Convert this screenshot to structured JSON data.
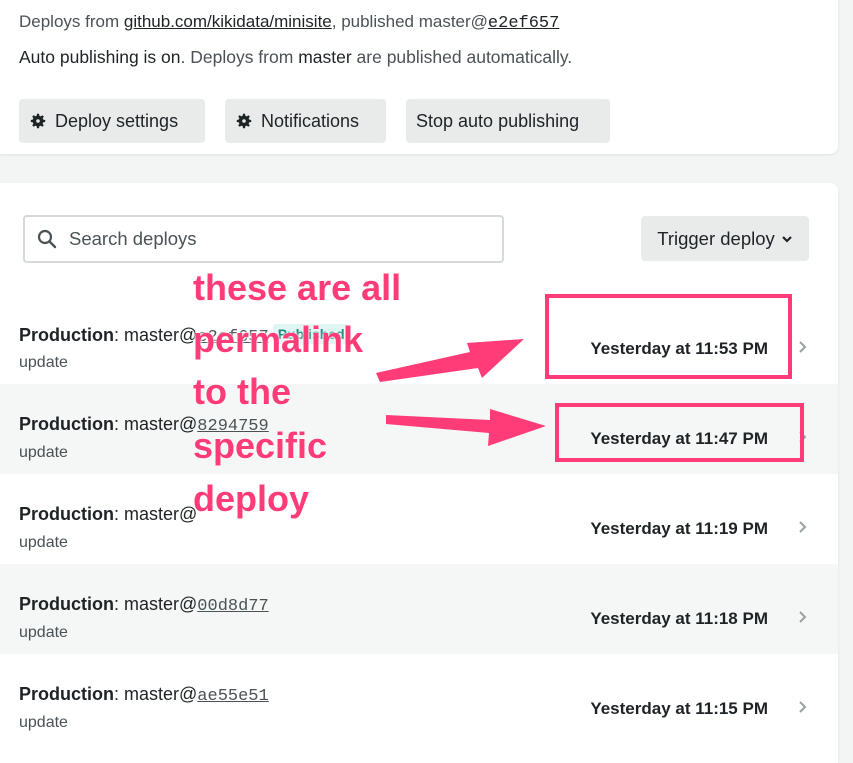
{
  "header": {
    "deploys_from_prefix": "Deploys from",
    "repo": "github.com/kikidata/minisite",
    "published_prefix": ", published master@",
    "published_sha": "e2ef657",
    "auto_strong": "Auto publishing is on",
    "auto_text1": ". Deploys from ",
    "auto_code": "master",
    "auto_text2": " are published automatically."
  },
  "toolbar": {
    "deploy_settings": "Deploy settings",
    "notifications": "Notifications",
    "stop_auto": "Stop auto publishing"
  },
  "search": {
    "placeholder": "Search deploys"
  },
  "trigger": {
    "label": "Trigger deploy"
  },
  "deploys": [
    {
      "context": "Production",
      "branch": ": master@",
      "sha": "e2ef657",
      "badge": "Published",
      "message": "update",
      "time": "Yesterday at 11:53 PM"
    },
    {
      "context": "Production",
      "branch": ": master@",
      "sha": "8294759",
      "badge": "",
      "message": "update",
      "time": "Yesterday at 11:47 PM"
    },
    {
      "context": "Production",
      "branch": ": master@",
      "sha": "",
      "badge": "",
      "message": "update",
      "time": "Yesterday at 11:19 PM"
    },
    {
      "context": "Production",
      "branch": ": master@",
      "sha": "00d8d77",
      "badge": "",
      "message": "update",
      "time": "Yesterday at 11:18 PM"
    },
    {
      "context": "Production",
      "branch": ": master@",
      "sha": "ae55e51",
      "badge": "",
      "message": "update",
      "time": "Yesterday at 11:15 PM"
    }
  ],
  "annotation": {
    "lines": [
      "these are all",
      "permalink",
      "to the",
      "specific",
      "deploy"
    ],
    "color": "#ff3c77"
  }
}
